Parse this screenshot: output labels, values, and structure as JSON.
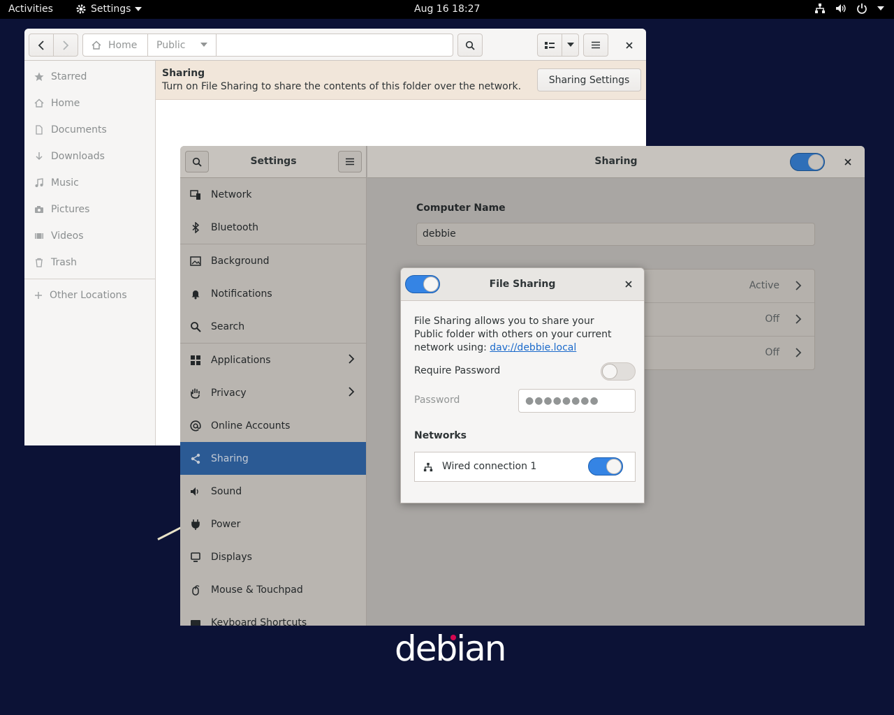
{
  "topbar": {
    "activities": "Activities",
    "app_menu": "Settings",
    "clock": "Aug 16  18:27"
  },
  "desktop": {
    "logo": "debian"
  },
  "files": {
    "path": [
      "Home",
      "Public"
    ],
    "sidebar": [
      {
        "label": "Starred",
        "icon": "star-icon"
      },
      {
        "label": "Home",
        "icon": "home-icon"
      },
      {
        "label": "Documents",
        "icon": "document-icon"
      },
      {
        "label": "Downloads",
        "icon": "download-icon"
      },
      {
        "label": "Music",
        "icon": "music-icon"
      },
      {
        "label": "Pictures",
        "icon": "camera-icon"
      },
      {
        "label": "Videos",
        "icon": "video-icon"
      },
      {
        "label": "Trash",
        "icon": "trash-icon"
      }
    ],
    "other_locations": "Other Locations",
    "banner": {
      "title": "Sharing",
      "text": "Turn on File Sharing to share the contents of this folder over the network.",
      "button": "Sharing Settings"
    }
  },
  "settings": {
    "sidebar_title": "Settings",
    "panel_title": "Sharing",
    "sharing_enabled": true,
    "nav": [
      {
        "label": "Network",
        "icon": "network-icon"
      },
      {
        "label": "Bluetooth",
        "icon": "bluetooth-icon"
      },
      {
        "label": "Background",
        "icon": "background-icon"
      },
      {
        "label": "Notifications",
        "icon": "bell-icon"
      },
      {
        "label": "Search",
        "icon": "search-icon"
      },
      {
        "label": "Applications",
        "icon": "applications-icon"
      },
      {
        "label": "Privacy",
        "icon": "hand-icon"
      },
      {
        "label": "Online Accounts",
        "icon": "at-icon"
      },
      {
        "label": "Sharing",
        "icon": "share-icon"
      },
      {
        "label": "Sound",
        "icon": "speaker-icon"
      },
      {
        "label": "Power",
        "icon": "power-plug-icon"
      },
      {
        "label": "Displays",
        "icon": "display-icon"
      },
      {
        "label": "Mouse & Touchpad",
        "icon": "mouse-icon"
      },
      {
        "label": "Keyboard Shortcuts",
        "icon": "keyboard-icon"
      }
    ],
    "computer_name_label": "Computer Name",
    "computer_name": "debbie",
    "services": [
      {
        "status": "Active"
      },
      {
        "status": "Off"
      },
      {
        "status": "Off"
      }
    ]
  },
  "dialog": {
    "title": "File Sharing",
    "enabled": true,
    "description_pre": "File Sharing allows you to share your Public folder with others on your current network using: ",
    "link": "dav://debbie.local",
    "require_password_label": "Require Password",
    "require_password": false,
    "password_label": "Password",
    "password_mask": "●●●●●●●●",
    "networks_label": "Networks",
    "networks": [
      {
        "name": "Wired connection 1",
        "enabled": true
      }
    ]
  },
  "colors": {
    "accent": "#3584e4",
    "selected_row": "#2b5a94",
    "desktop": "#0c1236",
    "debian_red": "#d70751"
  }
}
